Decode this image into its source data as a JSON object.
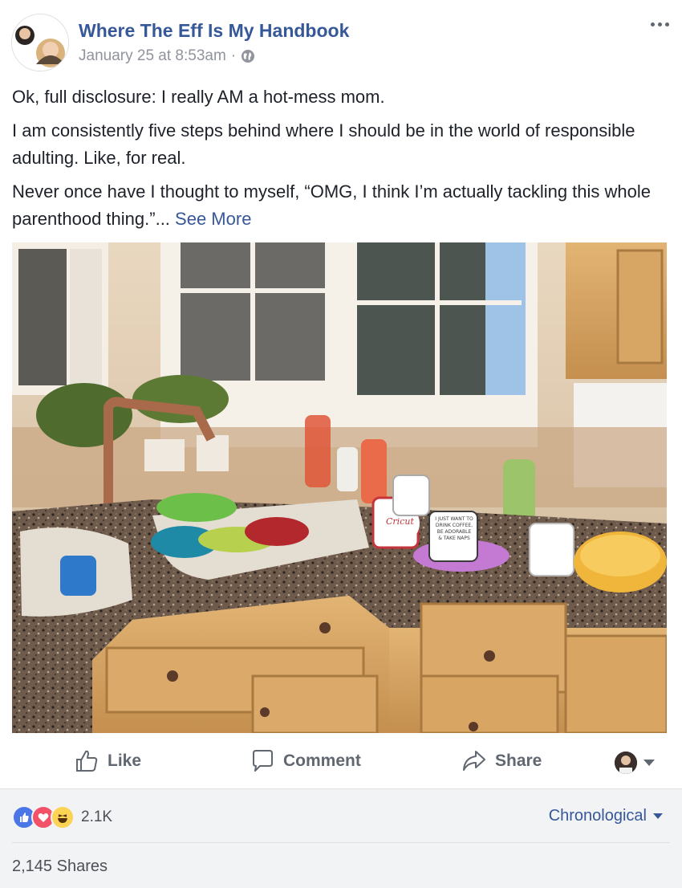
{
  "post": {
    "page_name": "Where The Eff Is My Handbook",
    "timestamp": "January 25 at 8:53am",
    "separator": "·",
    "privacy_icon": "globe-icon",
    "paragraphs": [
      "Ok, full disclosure: I really AM a hot-mess mom.",
      "I am consistently five steps behind where I should be in the world of responsible adulting. Like, for real.",
      "Never once have I thought to myself, “OMG, I think I’m actually tackling this whole parenthood thing.”..."
    ],
    "see_more_label": "See More",
    "mug_text": "I JUST WANT TO DRINK COFFEE, BE ADORABLE & TAKE NAPS",
    "mug_brand": "Cricut"
  },
  "actions": {
    "like_label": "Like",
    "comment_label": "Comment",
    "share_label": "Share"
  },
  "reactions": {
    "icons": [
      "like-icon",
      "love-icon",
      "haha-icon"
    ],
    "count": "2.1K",
    "sort_label": "Chronological",
    "shares_label": "2,145 Shares"
  },
  "colors": {
    "link": "#365899",
    "like_blue": "#4a76e8",
    "love_red": "#f25268",
    "haha_yellow": "#fcd354"
  }
}
